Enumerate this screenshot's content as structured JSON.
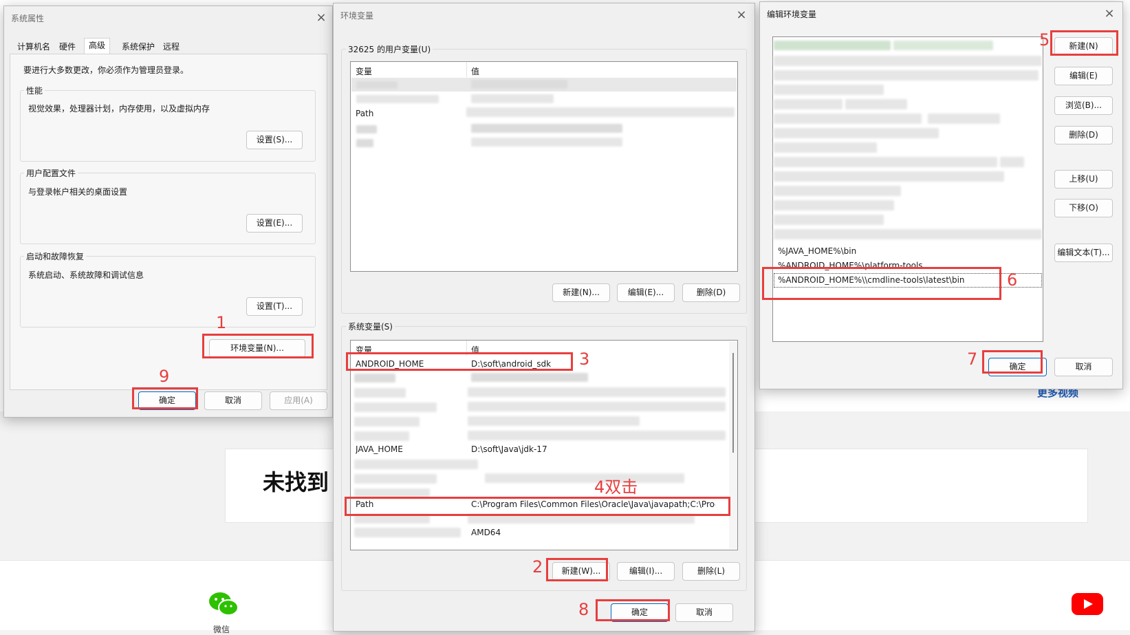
{
  "background": {
    "heading": "未找到",
    "more_videos": "更多视频",
    "wechat_label": "微信",
    "youtube_label": "YouTube"
  },
  "sys_props": {
    "title": "系统属性",
    "tabs": [
      "计算机名",
      "硬件",
      "高级",
      "系统保护",
      "远程"
    ],
    "active_tab": "高级",
    "admin_note": "要进行大多数更改，你必须作为管理员登录。",
    "performance": {
      "label": "性能",
      "desc": "视觉效果，处理器计划，内存使用，以及虚拟内存",
      "button": "设置(S)..."
    },
    "profiles": {
      "label": "用户配置文件",
      "desc": "与登录帐户相关的桌面设置",
      "button": "设置(E)..."
    },
    "startup": {
      "label": "启动和故障恢复",
      "desc": "系统启动、系统故障和调试信息",
      "button": "设置(T)..."
    },
    "env_button": "环境变量(N)...",
    "ok": "确定",
    "cancel": "取消",
    "apply": "应用(A)"
  },
  "env_vars": {
    "title": "环境变量",
    "user_group": "32625 的用户变量(U)",
    "col_var": "变量",
    "col_val": "值",
    "user_rows": [
      {
        "var": "Path",
        "val": ""
      }
    ],
    "user_new": "新建(N)...",
    "user_edit": "编辑(E)...",
    "user_delete": "删除(D)",
    "sys_group": "系统变量(S)",
    "sys_rows": [
      {
        "var": "ANDROID_HOME",
        "val": "D:\\soft\\android_sdk"
      },
      {
        "var": "JAVA_HOME",
        "val": "D:\\soft\\Java\\jdk-17"
      },
      {
        "var": "Path",
        "val": "C:\\Program Files\\Common Files\\Oracle\\Java\\javapath;C:\\Prog..."
      },
      {
        "var": "",
        "val": "AMD64"
      }
    ],
    "sys_new": "新建(W)...",
    "sys_edit": "编辑(I)...",
    "sys_delete": "删除(L)",
    "ok": "确定",
    "cancel": "取消"
  },
  "edit_env": {
    "title": "编辑环境变量",
    "entries": [
      "%JAVA_HOME%\\bin",
      "%ANDROID_HOME%\\platform-tools",
      "%ANDROID_HOME%\\\\cmdline-tools\\latest\\bin"
    ],
    "buttons": [
      "新建(N)",
      "编辑(E)",
      "浏览(B)...",
      "删除(D)",
      "上移(U)",
      "下移(O)",
      "编辑文本(T)..."
    ],
    "ok": "确定",
    "cancel": "取消"
  },
  "annotations": {
    "step1": "1",
    "step2": "2",
    "step3": "3",
    "step4": "4双击",
    "step5": "5",
    "step6": "6",
    "step7": "7",
    "step8": "8",
    "step9": "9",
    "color": "#e83e3e"
  }
}
